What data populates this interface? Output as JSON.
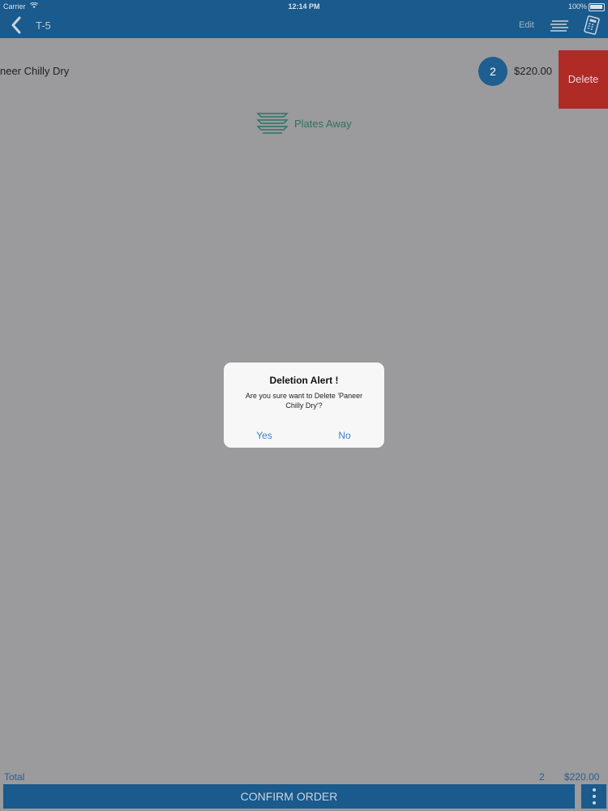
{
  "status_bar": {
    "carrier": "Carrier",
    "time": "12:14 PM",
    "battery": "100%"
  },
  "nav": {
    "title": "T-5",
    "edit_label": "Edit"
  },
  "order_item": {
    "name": "neer Chilly Dry",
    "quantity": "2",
    "price": "$220.00",
    "delete_label": "Delete"
  },
  "plates_away": {
    "label": "Plates Away"
  },
  "alert": {
    "title": "Deletion Alert !",
    "message": "Are you sure want to Delete 'Paneer Chilly Dry'?",
    "yes_label": "Yes",
    "no_label": "No"
  },
  "footer": {
    "total_label": "Total",
    "total_qty": "2",
    "total_amount": "$220.00",
    "confirm_label": "CONFIRM ORDER"
  },
  "colors": {
    "nav": "#1a5a8c",
    "overlay": "#9b9a9c",
    "delete": "#b02a26",
    "accent_blue": "#3a7fd0"
  }
}
